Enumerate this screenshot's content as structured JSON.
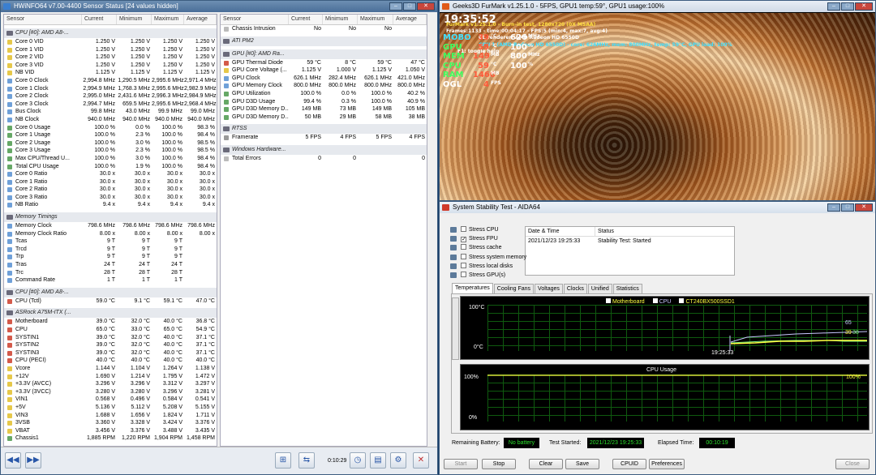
{
  "hwinfo": {
    "title": "HWiNFO64 v7.00-4400 Sensor Status [24 values hidden]",
    "timer": "0:10:29",
    "left": {
      "headers": [
        "Sensor",
        "Current",
        "Minimum",
        "Maximum",
        "Average"
      ],
      "groups": [
        {
          "title": "CPU [#0]: AMD A8-...",
          "rows": [
            [
              "Core 0 VID",
              "1.250 V",
              "1.250 V",
              "1.250 V",
              "1.250 V",
              "ivolt"
            ],
            [
              "Core 1 VID",
              "1.250 V",
              "1.250 V",
              "1.250 V",
              "1.250 V",
              "ivolt"
            ],
            [
              "Core 2 VID",
              "1.250 V",
              "1.250 V",
              "1.250 V",
              "1.250 V",
              "ivolt"
            ],
            [
              "Core 3 VID",
              "1.250 V",
              "1.250 V",
              "1.250 V",
              "1.250 V",
              "ivolt"
            ],
            [
              "NB VID",
              "1.125 V",
              "1.125 V",
              "1.125 V",
              "1.125 V",
              "ivolt"
            ],
            [
              "Core 0 Clock",
              "2,994.8 MHz",
              "1,290.5 MHz",
              "2,995.6 MHz",
              "2,971.4 MHz",
              "iclk"
            ],
            [
              "Core 1 Clock",
              "2,994.9 MHz",
              "1,768.3 MHz",
              "2,995.6 MHz",
              "2,982.9 MHz",
              "iclk"
            ],
            [
              "Core 2 Clock",
              "2,995.0 MHz",
              "2,431.6 MHz",
              "2,996.3 MHz",
              "2,984.9 MHz",
              "iclk"
            ],
            [
              "Core 3 Clock",
              "2,994.7 MHz",
              "659.5 MHz",
              "2,995.6 MHz",
              "2,968.4 MHz",
              "iclk"
            ],
            [
              "Bus Clock",
              "99.8 MHz",
              "43.0 MHz",
              "99.9 MHz",
              "99.0 MHz",
              "iclk"
            ],
            [
              "NB Clock",
              "940.0 MHz",
              "940.0 MHz",
              "940.0 MHz",
              "940.0 MHz",
              "iclk"
            ],
            [
              "Core 0 Usage",
              "100.0 %",
              "0.0 %",
              "100.0 %",
              "98.3 %",
              "iuse"
            ],
            [
              "Core 1 Usage",
              "100.0 %",
              "2.3 %",
              "100.0 %",
              "98.4 %",
              "iuse"
            ],
            [
              "Core 2 Usage",
              "100.0 %",
              "3.0 %",
              "100.0 %",
              "98.5 %",
              "iuse"
            ],
            [
              "Core 3 Usage",
              "100.0 %",
              "2.3 %",
              "100.0 %",
              "98.5 %",
              "iuse"
            ],
            [
              "Max CPU/Thread U...",
              "100.0 %",
              "3.0 %",
              "100.0 %",
              "98.4 %",
              "iuse"
            ],
            [
              "Total CPU Usage",
              "100.0 %",
              "1.9 %",
              "100.0 %",
              "98.4 %",
              "iuse"
            ],
            [
              "Core 0 Ratio",
              "30.0 x",
              "30.0 x",
              "30.0 x",
              "30.0 x",
              "iclk"
            ],
            [
              "Core 1 Ratio",
              "30.0 x",
              "30.0 x",
              "30.0 x",
              "30.0 x",
              "iclk"
            ],
            [
              "Core 2 Ratio",
              "30.0 x",
              "30.0 x",
              "30.0 x",
              "30.0 x",
              "iclk"
            ],
            [
              "Core 3 Ratio",
              "30.0 x",
              "30.0 x",
              "30.0 x",
              "30.0 x",
              "iclk"
            ],
            [
              "NB Ratio",
              "9.4 x",
              "9.4 x",
              "9.4 x",
              "9.4 x",
              "iclk"
            ]
          ]
        },
        {
          "title": "Memory Timings",
          "rows": [
            [
              "Memory Clock",
              "798.6 MHz",
              "798.6 MHz",
              "798.6 MHz",
              "798.6 MHz",
              "iclk"
            ],
            [
              "Memory Clock Ratio",
              "8.00 x",
              "8.00 x",
              "8.00 x",
              "8.00 x",
              "iclk"
            ],
            [
              "Tcas",
              "9 T",
              "9 T",
              "9 T",
              "",
              "iclk"
            ],
            [
              "Trcd",
              "9 T",
              "9 T",
              "9 T",
              "",
              "iclk"
            ],
            [
              "Trp",
              "9 T",
              "9 T",
              "9 T",
              "",
              "iclk"
            ],
            [
              "Tras",
              "24 T",
              "24 T",
              "24 T",
              "",
              "iclk"
            ],
            [
              "Trc",
              "28 T",
              "28 T",
              "28 T",
              "",
              "iclk"
            ],
            [
              "Command Rate",
              "1 T",
              "1 T",
              "1 T",
              "",
              "iclk"
            ]
          ]
        },
        {
          "title": "CPU [#0]: AMD A8-...",
          "rows": [
            [
              "CPU (Tctl)",
              "59.0 °C",
              "9.1 °C",
              "59.1 °C",
              "47.0 °C",
              "itemp"
            ]
          ]
        },
        {
          "title": "ASRock A75M-ITX (...",
          "rows": [
            [
              "Motherboard",
              "39.0 °C",
              "32.0 °C",
              "40.0 °C",
              "36.8 °C",
              "itemp"
            ],
            [
              "CPU",
              "65.0 °C",
              "33.0 °C",
              "65.0 °C",
              "54.9 °C",
              "itemp"
            ],
            [
              "SYSTIN1",
              "39.0 °C",
              "32.0 °C",
              "40.0 °C",
              "37.1 °C",
              "itemp"
            ],
            [
              "SYSTIN2",
              "39.0 °C",
              "32.0 °C",
              "40.0 °C",
              "37.1 °C",
              "itemp"
            ],
            [
              "SYSTIN3",
              "39.0 °C",
              "32.0 °C",
              "40.0 °C",
              "37.1 °C",
              "itemp"
            ],
            [
              "CPU (PECI)",
              "40.0 °C",
              "40.0 °C",
              "40.0 °C",
              "40.0 °C",
              "itemp"
            ],
            [
              "Vcore",
              "1.144 V",
              "1.104 V",
              "1.264 V",
              "1.138 V",
              "ivolt"
            ],
            [
              "+12V",
              "1.690 V",
              "1.214 V",
              "1.795 V",
              "1.472 V",
              "ivolt"
            ],
            [
              "+3.3V (AVCC)",
              "3.296 V",
              "3.296 V",
              "3.312 V",
              "3.297 V",
              "ivolt"
            ],
            [
              "+3.3V (3VCC)",
              "3.280 V",
              "3.280 V",
              "3.296 V",
              "3.281 V",
              "ivolt"
            ],
            [
              "VIN1",
              "0.568 V",
              "0.496 V",
              "0.584 V",
              "0.541 V",
              "ivolt"
            ],
            [
              "+5V",
              "5.136 V",
              "5.112 V",
              "5.208 V",
              "5.155 V",
              "ivolt"
            ],
            [
              "VIN3",
              "1.688 V",
              "1.656 V",
              "1.824 V",
              "1.711 V",
              "ivolt"
            ],
            [
              "3VSB",
              "3.360 V",
              "3.328 V",
              "3.424 V",
              "3.376 V",
              "ivolt"
            ],
            [
              "VBAT",
              "3.456 V",
              "3.376 V",
              "3.488 V",
              "3.435 V",
              "ivolt"
            ],
            [
              "Chassis1",
              "1,885 RPM",
              "1,220 RPM",
              "1,904 RPM",
              "1,458 RPM",
              "iuse"
            ]
          ]
        }
      ]
    },
    "right": {
      "headers": [
        "Sensor",
        "Current",
        "Minimum",
        "Maximum",
        "Average"
      ],
      "top": [
        [
          "Chassis Intrusion",
          "No",
          "No",
          "No",
          "",
          "ierr"
        ]
      ],
      "groups": [
        {
          "title": "ATI PM2",
          "rows": []
        },
        {
          "title": "GPU [#0]: AMD Ra...",
          "rows": [
            [
              "GPU Thermal Diode",
              "59 °C",
              "8 °C",
              "59 °C",
              "47 °C",
              "itemp"
            ],
            [
              "GPU Core Voltage (...",
              "1.125 V",
              "1.000 V",
              "1.125 V",
              "1.050 V",
              "ivolt"
            ],
            [
              "GPU Clock",
              "626.1 MHz",
              "282.4 MHz",
              "626.1 MHz",
              "421.0 MHz",
              "iclk"
            ],
            [
              "GPU Memory Clock",
              "800.0 MHz",
              "800.0 MHz",
              "800.0 MHz",
              "800.0 MHz",
              "iclk"
            ],
            [
              "GPU Utilization",
              "100.0 %",
              "0.0 %",
              "100.0 %",
              "40.2 %",
              "iuse"
            ],
            [
              "GPU D3D Usage",
              "99.4 %",
              "0.3 %",
              "100.0 %",
              "40.9 %",
              "iuse"
            ],
            [
              "GPU D3D Memory D...",
              "149 MB",
              "73 MB",
              "149 MB",
              "105 MB",
              "iuse"
            ],
            [
              "GPU D3D Memory D...",
              "50 MB",
              "29 MB",
              "58 MB",
              "38 MB",
              "iuse"
            ]
          ]
        },
        {
          "title": "RTSS",
          "rows": [
            [
              "Framerate",
              "5 FPS",
              "4 FPS",
              "5 FPS",
              "4 FPS",
              "ifps"
            ]
          ]
        },
        {
          "title": "Windows Hardware...",
          "rows": [
            [
              "Total Errors",
              "0",
              "0",
              "",
              "0",
              "ierr"
            ]
          ]
        }
      ]
    }
  },
  "furmark": {
    "title": "Geeks3D FurMark v1.25.1.0 - 5FPS, GPU1 temp:59°, GPU1 usage:100%",
    "time": "19:35:52",
    "line1": "FurMark v1.25.1.0 - Burn-in test, 1280x720 (0X MSAA)",
    "line2": "Frames:1133 - time:00:04:17 - FPS:5 (min:4, max:7, avg:4)",
    "line3": "GL renderer: AMD Radeon HD 6550D",
    "line4": "GPU 1 (AMD Radeon HD 6550D) - core: 626MHz, mem: 800MHz, temp: 59°C, GPU load: 100%",
    "line5": "F1: toggle help",
    "stats": [
      {
        "k": "MOBO",
        "v": "39",
        "u": "°C",
        "v2": "626",
        "u2": "MHz"
      },
      {
        "k": "GPU",
        "v": "59",
        "u": "°C",
        "v2": "100",
        "u2": "%"
      },
      {
        "k": "MEM",
        "v": "149",
        "u": "MB",
        "v2": "800",
        "u2": "MHz"
      },
      {
        "k": "CPU",
        "v": "59",
        "u": "°C",
        "v2": "100",
        "u2": "%"
      },
      {
        "k": "RAM",
        "v": "1460",
        "u": "MB",
        "v2": "",
        "": ""
      },
      {
        "k": "OGL",
        "v": "4",
        "u": "FPS",
        "v2": "",
        "u2": ""
      }
    ]
  },
  "aida": {
    "title": "System Stability Test - AIDA64",
    "stress": [
      {
        "label": "Stress CPU",
        "checked": false
      },
      {
        "label": "Stress FPU",
        "checked": true
      },
      {
        "label": "Stress cache",
        "checked": false
      },
      {
        "label": "Stress system memory",
        "checked": false
      },
      {
        "label": "Stress local disks",
        "checked": false
      },
      {
        "label": "Stress GPU(s)",
        "checked": false
      }
    ],
    "dt_header": "Date & Time",
    "status_header": "Status",
    "dt_value": "2021/12/23 19:25:33",
    "status_value": "Stability Test: Started",
    "tabs": [
      "Temperatures",
      "Cooling Fans",
      "Voltages",
      "Clocks",
      "Unified",
      "Statistics"
    ],
    "legend": [
      "Motherboard",
      "CPU",
      "CT240BX500SSD1"
    ],
    "temp_top": "100°C",
    "temp_bottom": "0°C",
    "temp_time": "19:25:33",
    "temp_val1": "65",
    "temp_val2": "39",
    "temp_val3": "38",
    "cpu_title": "CPU Usage",
    "cpu_top": "100%",
    "cpu_bottom": "0%",
    "cpu_right": "100%",
    "battery_label": "Remaining Battery:",
    "battery_value": "No battery",
    "started_label": "Test Started:",
    "started_value": "2021/12/23 19:25:33",
    "elapsed_label": "Elapsed Time:",
    "elapsed_value": "00:10:19",
    "buttons": [
      "Start",
      "Stop",
      "Clear",
      "Save",
      "CPUID",
      "Preferences",
      "Close"
    ],
    "colors": {
      "mobo": "#ffff40",
      "cpu": "#c8c8ff",
      "ssd": "#7cf07c",
      "grid": "#0f5a0f"
    }
  }
}
